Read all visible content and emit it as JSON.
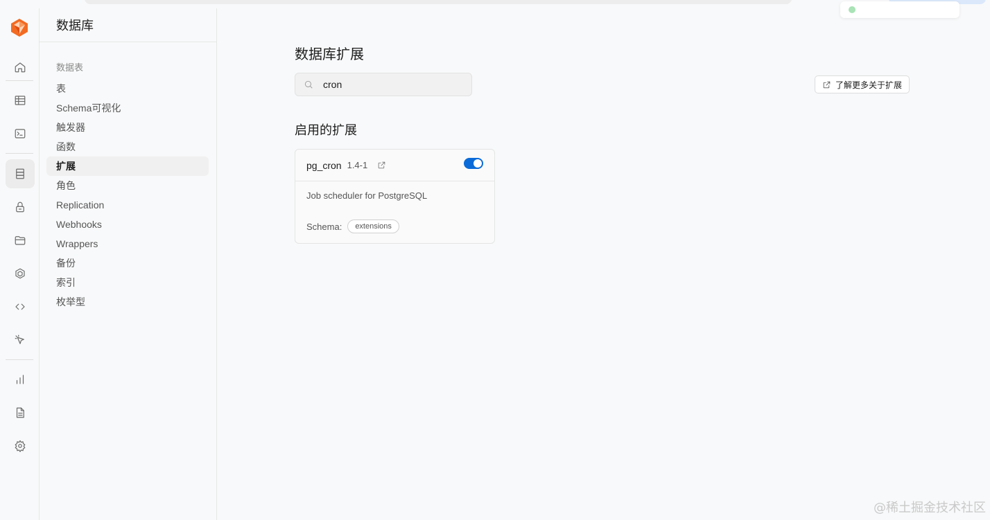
{
  "toast": {
    "text": ""
  },
  "sidebar": {
    "title": "数据库",
    "section_title": "数据表",
    "items": [
      {
        "label": "表"
      },
      {
        "label": "Schema可视化"
      },
      {
        "label": "触发器"
      },
      {
        "label": "函数"
      },
      {
        "label": "扩展",
        "active": true
      },
      {
        "label": "角色"
      },
      {
        "label": "Replication"
      },
      {
        "label": "Webhooks"
      },
      {
        "label": "Wrappers"
      },
      {
        "label": "备份"
      },
      {
        "label": "索引"
      },
      {
        "label": "枚举型"
      }
    ]
  },
  "rail": {
    "icons": [
      "home-icon",
      "table-editor-icon",
      "sql-editor-icon",
      "database-icon",
      "auth-lock-icon",
      "storage-icon",
      "edge-functions-icon",
      "api-code-icon",
      "realtime-cursor-icon",
      "reports-chart-icon",
      "logs-document-icon",
      "settings-gear-icon"
    ],
    "active": "database-icon"
  },
  "main": {
    "title": "数据库扩展",
    "search_value": "cron",
    "learn_more": "了解更多关于扩展",
    "enabled_heading": "启用的扩展"
  },
  "extension": {
    "name": "pg_cron",
    "version": "1.4-1",
    "enabled": true,
    "description": "Job scheduler for PostgreSQL",
    "schema_label": "Schema:",
    "schema_value": "extensions"
  },
  "colors": {
    "accent": "#0a6bd8",
    "brand": "#f26b22"
  },
  "watermark": "@稀土掘金技术社区"
}
